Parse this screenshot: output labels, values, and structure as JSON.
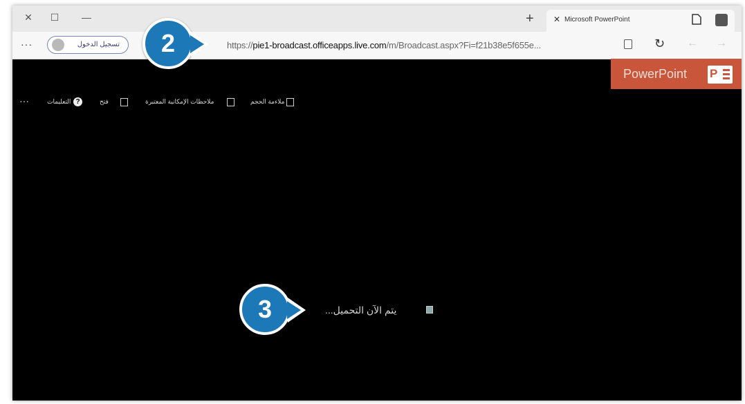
{
  "titlebar": {
    "close_glyph": "✕",
    "maximize_glyph": "☐",
    "minimize_glyph": "—",
    "newtab_glyph": "+",
    "tab": {
      "close_glyph": "✕",
      "title": "Microsoft PowerPoint"
    }
  },
  "addressbar": {
    "more_glyph": "···",
    "signin_label": "تسجيل الدخول",
    "url_prefix": "https://",
    "url_host": "pie1-broadcast.officeapps.live.com",
    "url_path": "/m/Broadcast.aspx?Fi=f21b38e5f655e...",
    "refresh_glyph": "↻",
    "back_glyph": "←",
    "forward_glyph": "→"
  },
  "brand": {
    "label": "PowerPoint",
    "logo_letter": "P"
  },
  "toolbar": {
    "more_glyph": "···",
    "help_label": "التعليمات",
    "help_glyph": "?",
    "follow_label": "فتح",
    "accessibility_label": "ملاحظات الإمكانية المعتبرة",
    "fit_label": "ملاءمة الحجم"
  },
  "content": {
    "loading_text": "...يتم الآن التحميل"
  },
  "callouts": {
    "first": "2",
    "second": "3"
  },
  "colors": {
    "callout_blue": "#1d78b8",
    "ppt_orange": "#c9553a",
    "background": "#000000"
  }
}
